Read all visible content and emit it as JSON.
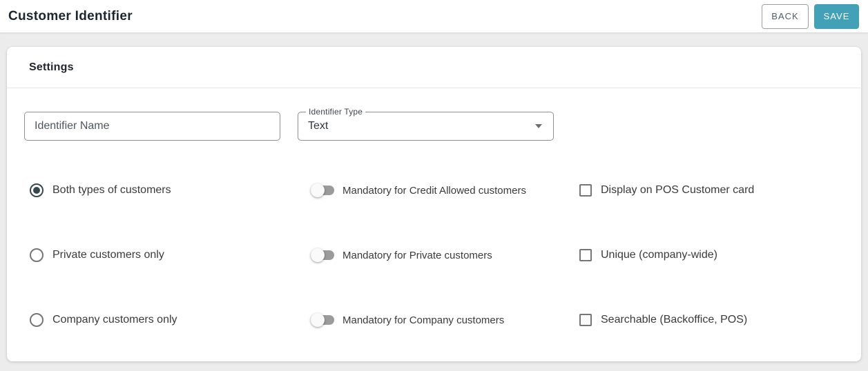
{
  "header": {
    "title": "Customer Identifier",
    "back_label": "BACK",
    "save_label": "SAVE"
  },
  "panel": {
    "title": "Settings"
  },
  "fields": {
    "identifier_name": {
      "placeholder": "Identifier Name",
      "value": ""
    },
    "identifier_type": {
      "label": "Identifier Type",
      "value": "Text"
    }
  },
  "radios": [
    {
      "label": "Both types of customers",
      "selected": true
    },
    {
      "label": "Private customers only",
      "selected": false
    },
    {
      "label": "Company customers only",
      "selected": false
    }
  ],
  "toggles": [
    {
      "label": "Mandatory for Credit Allowed customers",
      "on": false
    },
    {
      "label": "Mandatory for Private customers",
      "on": false
    },
    {
      "label": "Mandatory for Company customers",
      "on": false
    }
  ],
  "checkboxes": [
    {
      "label": "Display on POS Customer card",
      "checked": false
    },
    {
      "label": "Unique (company-wide)",
      "checked": false
    },
    {
      "label": "Searchable (Backoffice, POS)",
      "checked": false
    }
  ],
  "colors": {
    "accent_teal": "#42a1b6",
    "radio_selected": "#37474f",
    "page_background": "#ececec"
  }
}
